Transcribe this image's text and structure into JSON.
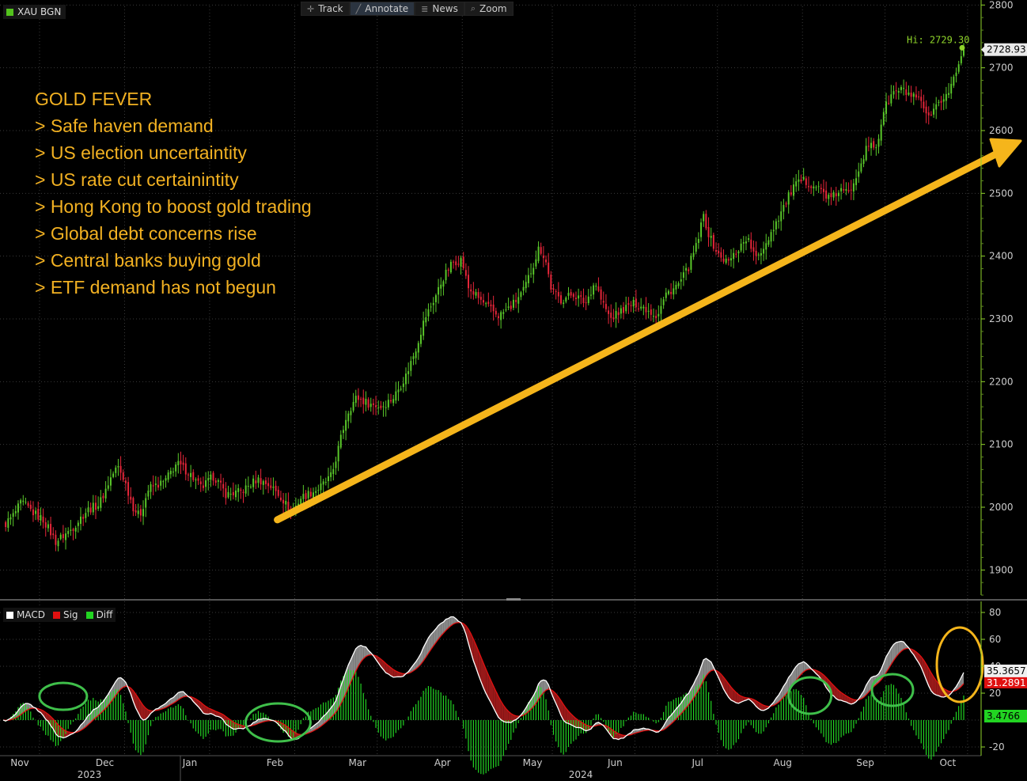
{
  "ticker": {
    "label": "XAU BGN",
    "color": "#53c21d"
  },
  "toolbar": {
    "items": [
      {
        "label": "Track",
        "icon": "crosshair-icon",
        "glyph": "✛"
      },
      {
        "label": "Annotate",
        "icon": "pencil-icon",
        "glyph": "╱",
        "active": true
      },
      {
        "label": "News",
        "icon": "news-icon",
        "glyph": "≣"
      },
      {
        "label": "Zoom",
        "icon": "magnifier-icon",
        "glyph": "⌕"
      }
    ]
  },
  "annotation": {
    "color": "#f2b122",
    "lines": [
      "GOLD FEVER",
      "> Safe haven demand",
      "> US election uncertaintity",
      "> US rate cut certainintity",
      "> Hong Kong to boost gold trading",
      "> Global debt concerns rise",
      "> Central banks buying gold",
      "> ETF demand has not begun"
    ]
  },
  "macd_legend": [
    {
      "label": "MACD",
      "color": "#ffffff"
    },
    {
      "label": "Sig",
      "color": "#e01010"
    },
    {
      "label": "Diff",
      "color": "#22d422"
    }
  ],
  "chart_data": [
    {
      "type": "candlestick",
      "series_name": "XAU BGN",
      "ylim": [
        1850,
        2820
      ],
      "y_ticks": [
        1900,
        2000,
        2100,
        2200,
        2300,
        2400,
        2500,
        2600,
        2700,
        2800
      ],
      "high_label": "Hi: 2729.30",
      "high_value": 2729.3,
      "last_value": 2728.93,
      "last_label": "2728.93",
      "colors": {
        "up": "#5ac92a",
        "down": "#e8263a",
        "accent": "#8fd42a",
        "arrow": "#f5b51b"
      },
      "anchors": [
        [
          0,
          1970
        ],
        [
          3,
          1985
        ],
        [
          6,
          2008
        ],
        [
          10,
          1990
        ],
        [
          13,
          1980
        ],
        [
          17,
          1945
        ],
        [
          22,
          1965
        ],
        [
          27,
          1995
        ],
        [
          31,
          2005
        ],
        [
          35,
          2050
        ],
        [
          37,
          2065
        ],
        [
          39,
          2045
        ],
        [
          42,
          2000
        ],
        [
          44,
          1985
        ],
        [
          47,
          2030
        ],
        [
          52,
          2040
        ],
        [
          56,
          2070
        ],
        [
          60,
          2055
        ],
        [
          64,
          2030
        ],
        [
          68,
          2050
        ],
        [
          72,
          2020
        ],
        [
          77,
          2025
        ],
        [
          82,
          2045
        ],
        [
          86,
          2035
        ],
        [
          90,
          2015
        ],
        [
          93,
          1990
        ],
        [
          96,
          2015
        ],
        [
          102,
          2030
        ],
        [
          106,
          2050
        ],
        [
          108,
          2090
        ],
        [
          111,
          2150
        ],
        [
          114,
          2175
        ],
        [
          118,
          2165
        ],
        [
          122,
          2160
        ],
        [
          126,
          2175
        ],
        [
          130,
          2210
        ],
        [
          133,
          2250
        ],
        [
          136,
          2300
        ],
        [
          139,
          2330
        ],
        [
          142,
          2365
        ],
        [
          145,
          2390
        ],
        [
          148,
          2395
        ],
        [
          150,
          2350
        ],
        [
          153,
          2335
        ],
        [
          156,
          2320
        ],
        [
          160,
          2305
        ],
        [
          164,
          2320
        ],
        [
          168,
          2345
        ],
        [
          171,
          2385
        ],
        [
          173,
          2415
        ],
        [
          175,
          2395
        ],
        [
          177,
          2345
        ],
        [
          180,
          2330
        ],
        [
          184,
          2340
        ],
        [
          188,
          2325
        ],
        [
          191,
          2360
        ],
        [
          193,
          2330
        ],
        [
          196,
          2300
        ],
        [
          200,
          2315
        ],
        [
          204,
          2325
        ],
        [
          208,
          2315
        ],
        [
          211,
          2305
        ],
        [
          214,
          2340
        ],
        [
          218,
          2355
        ],
        [
          221,
          2380
        ],
        [
          224,
          2420
        ],
        [
          226,
          2465
        ],
        [
          228,
          2430
        ],
        [
          231,
          2400
        ],
        [
          234,
          2390
        ],
        [
          237,
          2410
        ],
        [
          240,
          2430
        ],
        [
          243,
          2395
        ],
        [
          246,
          2420
        ],
        [
          249,
          2450
        ],
        [
          252,
          2480
        ],
        [
          255,
          2510
        ],
        [
          258,
          2520
        ],
        [
          261,
          2515
        ],
        [
          264,
          2505
        ],
        [
          267,
          2490
        ],
        [
          270,
          2505
        ],
        [
          273,
          2500
        ],
        [
          276,
          2540
        ],
        [
          279,
          2575
        ],
        [
          282,
          2575
        ],
        [
          284,
          2630
        ],
        [
          287,
          2660
        ],
        [
          290,
          2665
        ],
        [
          293,
          2655
        ],
        [
          296,
          2645
        ],
        [
          299,
          2615
        ],
        [
          302,
          2645
        ],
        [
          305,
          2660
        ],
        [
          308,
          2700
        ],
        [
          310,
          2729
        ]
      ]
    },
    {
      "type": "line",
      "series": [
        {
          "name": "MACD",
          "values": "computed"
        },
        {
          "name": "Sig",
          "values": "computed"
        },
        {
          "name": "Diff",
          "values": "computed"
        }
      ],
      "ylim": [
        -26,
        84
      ],
      "y_ticks": [
        -20,
        20,
        40,
        60,
        80
      ],
      "macd_last": 35.3657,
      "macd_last_label": "35.3657",
      "sig_last_label": "31.2891",
      "diff_last": 3.4766,
      "diff_last_label": "3.4766",
      "colors": {
        "macd": "#ffffff",
        "sig": "#e01010",
        "diff": "#22d422",
        "fill_up": "#8f8f8f",
        "fill_down": "#a01a1a",
        "circle": "#3fbf4a",
        "oval": "#f5b51b"
      }
    }
  ],
  "x_axis": {
    "months": [
      {
        "label": "Nov",
        "i": 6
      },
      {
        "label": "Dec",
        "i": 40
      },
      {
        "label": "Jan",
        "i": 74
      },
      {
        "label": "Feb",
        "i": 108
      },
      {
        "label": "Mar",
        "i": 141
      },
      {
        "label": "Apr",
        "i": 175
      },
      {
        "label": "May",
        "i": 211
      },
      {
        "label": "Jun",
        "i": 244
      },
      {
        "label": "Jul",
        "i": 277
      },
      {
        "label": "Aug",
        "i": 311
      },
      {
        "label": "Sep",
        "i": 344
      },
      {
        "label": "Oct",
        "i": 377
      }
    ],
    "years": [
      {
        "label": "2023"
      },
      {
        "label": "2024"
      }
    ]
  }
}
